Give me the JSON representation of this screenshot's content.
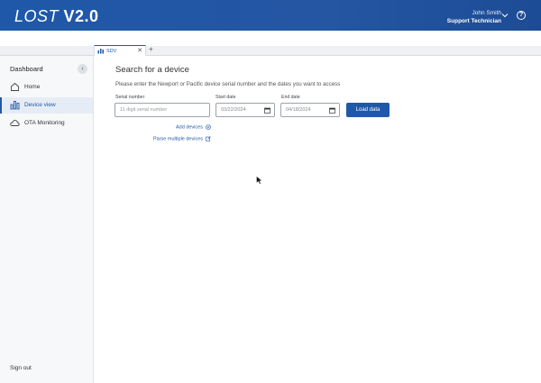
{
  "header": {
    "logo_main": "LOST",
    "logo_version": "V2.0",
    "user_name": "John Smith",
    "user_role": "Support Technician",
    "help_glyph": "?"
  },
  "tabs": {
    "active_label": "SDV",
    "close_glyph": "✕",
    "add_glyph": "+"
  },
  "sidebar": {
    "title": "Dashboard",
    "collapse_glyph": "‹",
    "items": [
      {
        "label": "Home",
        "icon": "home-icon"
      },
      {
        "label": "Device view",
        "icon": "bar-chart-icon"
      },
      {
        "label": "OTA Monitoring",
        "icon": "cloud-icon"
      }
    ],
    "signout": "Sign out"
  },
  "main": {
    "title": "Search for a device",
    "description": "Please enter the Newport or Pacific device serial number and the dates you want to access",
    "serial_label": "Serial number",
    "serial_placeholder": "11 digit serial number",
    "start_label": "Start date",
    "start_value": "03/22/2024",
    "end_label": "End date",
    "end_value": "04/18/2024",
    "load_button": "Load data",
    "add_devices": "Add devices",
    "parse_devices": "Parse multiple devices"
  },
  "colors": {
    "brand": "#1f58a8",
    "sidebar_bg": "#f7f8fa"
  }
}
